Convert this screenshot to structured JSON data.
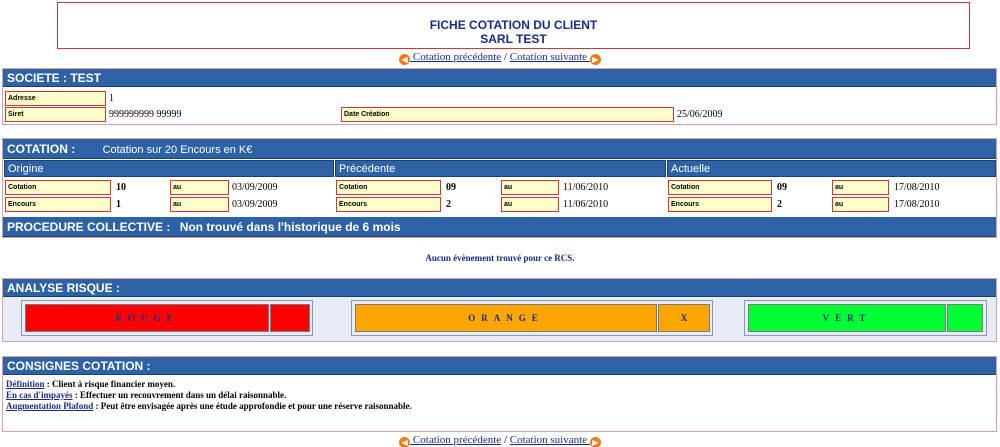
{
  "title": {
    "line1": "FICHE COTATION DU CLIENT",
    "line2": "SARL TEST"
  },
  "nav": {
    "prev": " Cotation précédente",
    "sep": " / ",
    "next": "Cotation suivante "
  },
  "societe": {
    "header": "SOCIETE : TEST",
    "adresse_label": "Adresse",
    "adresse_value": "1",
    "siret_label": "Siret",
    "siret_value": "999999999  99999",
    "date_label": "Date Création",
    "date_value": "25/06/2009"
  },
  "cotation": {
    "header": "COTATION :",
    "subtitle": "Cotation sur 20  Encours en K€",
    "columns": [
      {
        "title": "Origine",
        "cotation_label": "Cotation",
        "cotation_value": "10",
        "au1": "au",
        "date1": "03/09/2009",
        "encours_label": "Encours",
        "encours_value": "1",
        "au2": "au",
        "date2": "03/09/2009"
      },
      {
        "title": "Précédente",
        "cotation_label": "Cotation",
        "cotation_value": "09",
        "au1": "au",
        "date1": "11/06/2010",
        "encours_label": "Encours",
        "encours_value": "2",
        "au2": "au",
        "date2": "11/06/2010"
      },
      {
        "title": "Actuelle",
        "cotation_label": "Cotation",
        "cotation_value": "09",
        "au1": "au",
        "date1": "17/08/2010",
        "encours_label": "Encours",
        "encours_value": "2",
        "au2": "au",
        "date2": "17/08/2010"
      }
    ]
  },
  "procedure": {
    "header": "PROCEDURE COLLECTIVE :",
    "text": "Non trouvé dans l'historique de 6 mois"
  },
  "message": "Aucun évènement trouvé pour ce RCS.",
  "analyse": {
    "header": "ANALYSE RISQUE :",
    "rouge": "ROUGE",
    "rouge_mark": "",
    "orange": "ORANGE",
    "orange_mark": "X",
    "vert": "VERT",
    "vert_mark": "",
    "colors": {
      "rouge": "#ff0000",
      "orange": "#ffa500",
      "vert": "#00ff33"
    }
  },
  "consignes": {
    "header": "CONSIGNES COTATION :",
    "items": [
      {
        "label": "Définition",
        "text": " : Client à risque financier moyen."
      },
      {
        "label": "En cas d'impayés",
        "text": " : Effectuer un recouvrement dans un délai raisonnable."
      },
      {
        "label": "Augmentation Plafond",
        "text": " : Peut être envisagée après une étude approfondie et pour une réserve raisonnable."
      }
    ]
  }
}
